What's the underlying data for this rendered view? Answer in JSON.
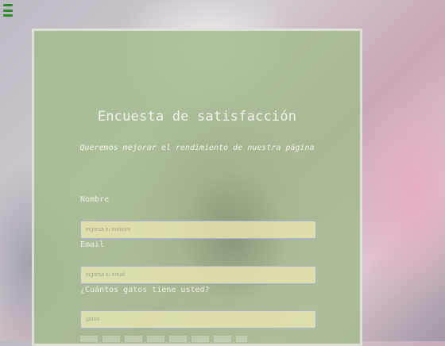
{
  "menu": {
    "icon": "hamburger-menu-icon"
  },
  "survey": {
    "title": "Encuesta de satisfacción",
    "subtitle": "Queremos mejorar el rendimiento de nuestra página",
    "fields": [
      {
        "label": "Nombre",
        "placeholder": "ingresa tu nombre",
        "value": ""
      },
      {
        "label": "Email",
        "placeholder": "ingresa tu email",
        "value": ""
      },
      {
        "label": "¿Cuántos gatos tiene usted?",
        "placeholder": "gatos",
        "value": ""
      }
    ]
  },
  "colors": {
    "menu_icon": "#2f8a2a",
    "card_overlay": "#a2bc8c",
    "input_background": "#ece8b4",
    "input_border": "#a9b4d6",
    "text": "#f1f3ea"
  }
}
